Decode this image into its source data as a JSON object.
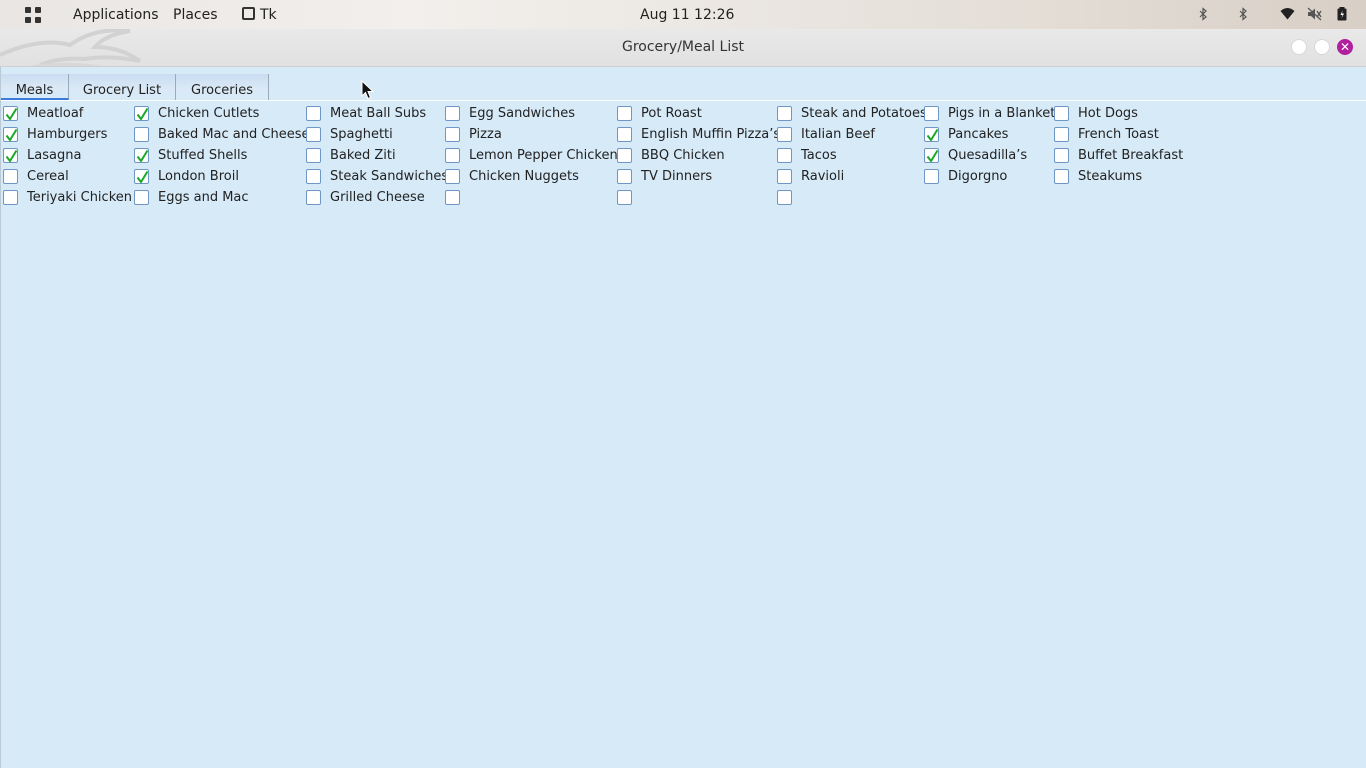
{
  "top_panel": {
    "applications": "Applications",
    "places": "Places",
    "active_app": "Tk",
    "clock": "Aug 11  12:26",
    "tray_icons": [
      "bluetooth-icon",
      "bluetooth-icon",
      "wifi-icon",
      "volume-muted-icon",
      "battery-icon"
    ]
  },
  "window": {
    "title": "Grocery/Meal List"
  },
  "tabs": [
    {
      "label": "Meals",
      "active": true
    },
    {
      "label": "Grocery List",
      "active": false
    },
    {
      "label": "Groceries",
      "active": false
    }
  ],
  "colors": {
    "check": "#1aa826",
    "checkbox_border": "#6f97c6",
    "background": "#d6eaf8",
    "close_button": "#b0209e"
  },
  "meals": {
    "columns": [
      [
        {
          "label": "Meatloaf",
          "checked": true
        },
        {
          "label": "Hamburgers",
          "checked": true
        },
        {
          "label": "Lasagna",
          "checked": true
        },
        {
          "label": "Cereal",
          "checked": false
        },
        {
          "label": "Teriyaki Chicken",
          "checked": false
        }
      ],
      [
        {
          "label": "Chicken Cutlets",
          "checked": true
        },
        {
          "label": "Baked Mac and Cheese",
          "checked": false
        },
        {
          "label": "Stuffed Shells",
          "checked": true
        },
        {
          "label": "London Broil",
          "checked": true
        },
        {
          "label": "Eggs and Mac",
          "checked": false
        }
      ],
      [
        {
          "label": "Meat Ball Subs",
          "checked": false
        },
        {
          "label": "Spaghetti",
          "checked": false
        },
        {
          "label": "Baked Ziti",
          "checked": false
        },
        {
          "label": "Steak Sandwiches",
          "checked": false
        },
        {
          "label": "Grilled Cheese",
          "checked": false
        }
      ],
      [
        {
          "label": "Egg Sandwiches",
          "checked": false
        },
        {
          "label": "Pizza",
          "checked": false
        },
        {
          "label": "Lemon Pepper Chicken",
          "checked": false
        },
        {
          "label": "Chicken Nuggets",
          "checked": false
        },
        {
          "label": "",
          "checked": false
        }
      ],
      [
        {
          "label": "Pot Roast",
          "checked": false
        },
        {
          "label": "English Muffin Pizza’s",
          "checked": false
        },
        {
          "label": "BBQ Chicken",
          "checked": false
        },
        {
          "label": "TV Dinners",
          "checked": false
        },
        {
          "label": "",
          "checked": false
        }
      ],
      [
        {
          "label": "Steak and Potatoes",
          "checked": false
        },
        {
          "label": "Italian Beef",
          "checked": false
        },
        {
          "label": "Tacos",
          "checked": false
        },
        {
          "label": "Ravioli",
          "checked": false
        },
        {
          "label": "",
          "checked": false
        }
      ],
      [
        {
          "label": "Pigs in a Blanket",
          "checked": false
        },
        {
          "label": "Pancakes",
          "checked": true
        },
        {
          "label": "Quesadilla’s",
          "checked": true
        },
        {
          "label": "Digorgno",
          "checked": false
        }
      ],
      [
        {
          "label": "Hot Dogs",
          "checked": false
        },
        {
          "label": "French Toast",
          "checked": false
        },
        {
          "label": "Buffet Breakfast",
          "checked": false
        },
        {
          "label": "Steakums",
          "checked": false
        }
      ]
    ]
  }
}
